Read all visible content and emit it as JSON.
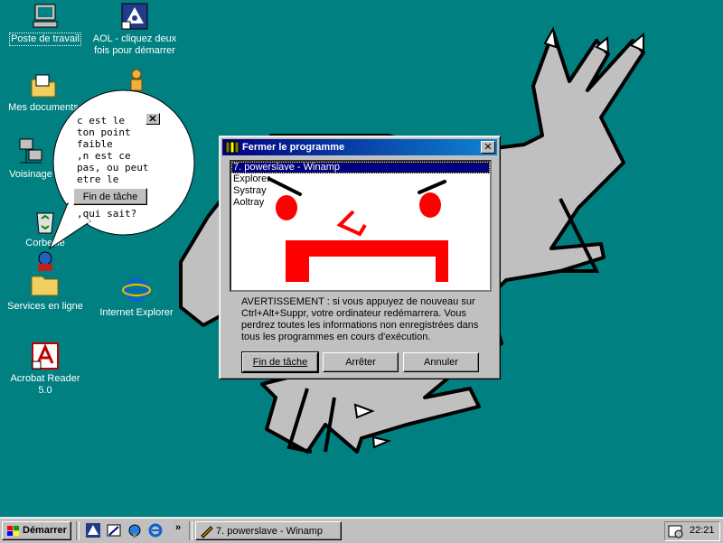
{
  "desktop": {
    "icons": [
      {
        "label": "Poste de travail"
      },
      {
        "label": "AOL - cliquez deux fois pour démarrer"
      },
      {
        "label": "Mes documents"
      },
      {
        "label": "Voisinage"
      },
      {
        "label": "Corbeille"
      },
      {
        "label": "Services en ligne"
      },
      {
        "label": "Internet Explorer"
      },
      {
        "label": "Acrobat Reader 5.0"
      }
    ],
    "bg_color": "#008080"
  },
  "bubble": {
    "text": "c est le\nton point\nfaible\n,n est ce\npas, ou peut\netre le",
    "button_label": "Fin de tâche",
    "tail_text": ",qui sait?",
    "close_label": "✕"
  },
  "dialog": {
    "title": "Fermer le programme",
    "close_label": "✕",
    "tasks": [
      {
        "label": "7. powerslave - Winamp",
        "selected": true
      },
      {
        "label": "Explorer"
      },
      {
        "label": "Systray"
      },
      {
        "label": "Aoltray"
      }
    ],
    "warning": "AVERTISSEMENT : si vous appuyez de nouveau sur Ctrl+Alt+Suppr, votre ordinateur redémarrera. Vous perdrez toutes les informations non enregistrées dans tous les programmes en cours d'exécution.",
    "buttons": {
      "end_task": "Fin de tâche",
      "shutdown": "Arrêter",
      "cancel": "Annuler"
    }
  },
  "taskbar": {
    "start_label": "Démarrer",
    "more_label": "»",
    "tasks": [
      {
        "label": "7. powerslave - Winamp"
      }
    ],
    "clock": "22:21"
  },
  "icons_semantic": [
    "my-computer-icon",
    "aol-icon",
    "documents-folder-icon",
    "network-icon",
    "recycle-bin-icon",
    "online-services-icon",
    "internet-explorer-icon",
    "acrobat-icon"
  ]
}
